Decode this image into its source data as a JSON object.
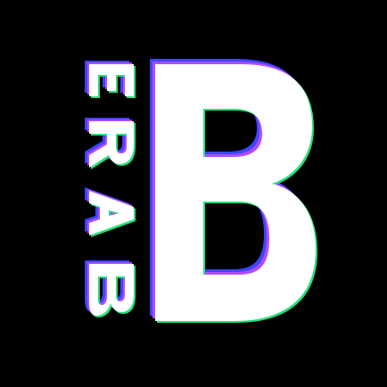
{
  "logo": {
    "wordmark": "BARE",
    "monogram": "B",
    "colors": {
      "background": "#000000",
      "main": "#ffffff",
      "glitch_blue": "#3b46ff",
      "glitch_purple": "#b24cff",
      "glitch_green": "#25e07a"
    }
  }
}
